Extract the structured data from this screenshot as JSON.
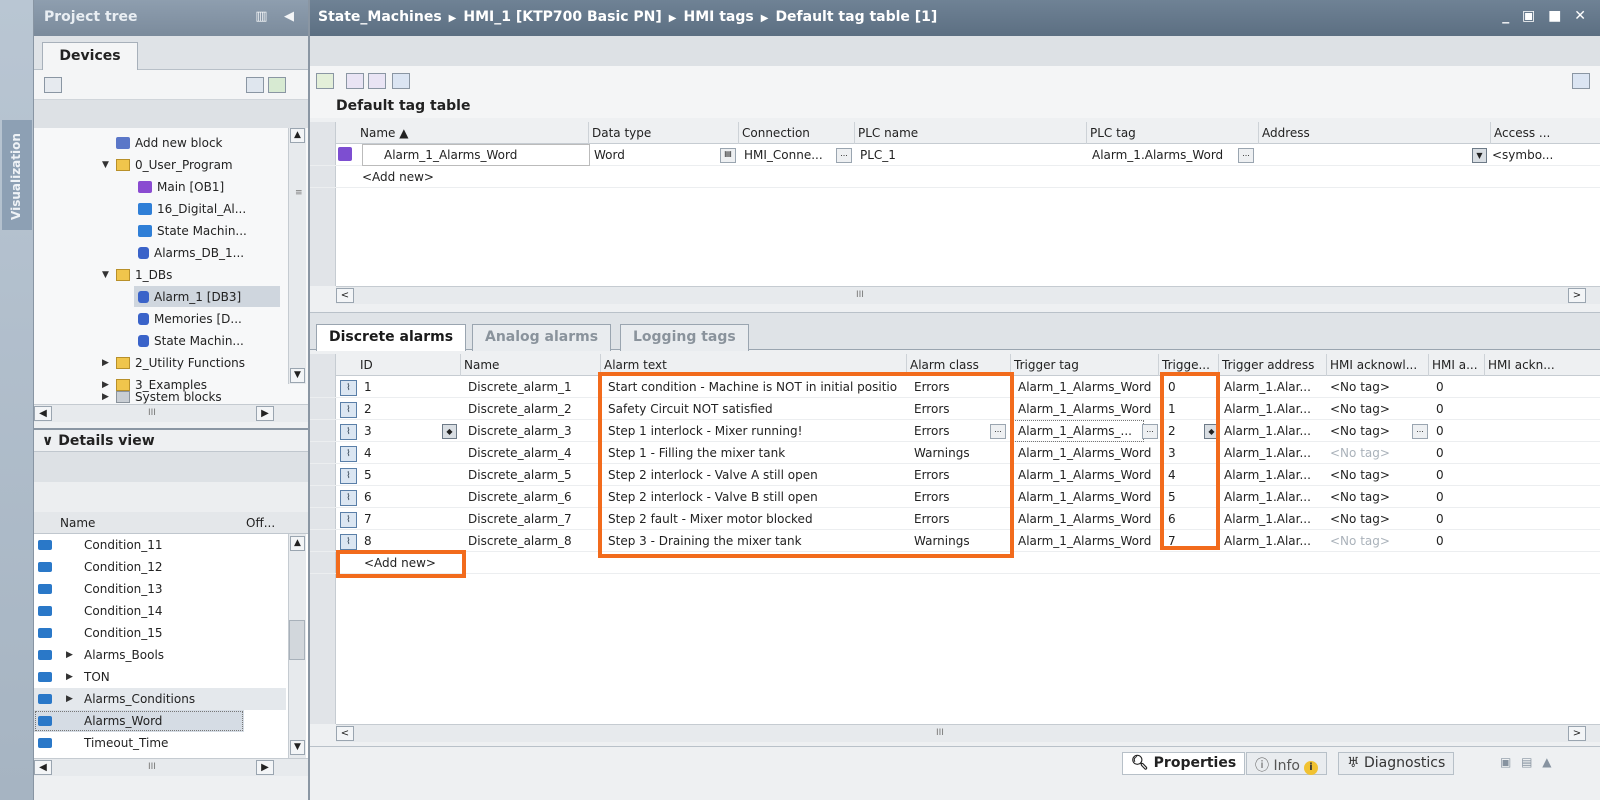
{
  "side_strip": {
    "label": "Visualization"
  },
  "project_tree": {
    "title": "Project tree",
    "tab": "Devices",
    "items": [
      {
        "label": "Add new block",
        "icon": "add-block-icon"
      },
      {
        "label": "0_User_Program",
        "icon": "folder-icon"
      },
      {
        "label": "Main [OB1]",
        "icon": "ob-icon"
      },
      {
        "label": "16_Digital_Al...",
        "icon": "fb-icon"
      },
      {
        "label": "State Machin...",
        "icon": "fb-icon"
      },
      {
        "label": "Alarms_DB_1...",
        "icon": "db-icon"
      },
      {
        "label": "1_DBs",
        "icon": "folder-icon"
      },
      {
        "label": "Alarm_1 [DB3]",
        "icon": "db-icon"
      },
      {
        "label": "Memories [D...",
        "icon": "db-icon"
      },
      {
        "label": "State Machin...",
        "icon": "db-icon"
      },
      {
        "label": "2_Utility Functions",
        "icon": "folder-icon"
      },
      {
        "label": "3_Examples",
        "icon": "folder-icon"
      },
      {
        "label": "System blocks",
        "icon": "folder-icon"
      }
    ]
  },
  "details_view": {
    "title": "Details view",
    "col_name": "Name",
    "col_offset": "Off...",
    "items": [
      "Condition_11",
      "Condition_12",
      "Condition_13",
      "Condition_14",
      "Condition_15",
      "Alarms_Bools",
      "TON",
      "Alarms_Conditions",
      "Alarms_Word",
      "Timeout_Time"
    ]
  },
  "breadcrumb": {
    "parts": [
      "State_Machines",
      "HMI_1 [KTP700 Basic PN]",
      "HMI tags",
      "Default tag table [1]"
    ],
    "window_controls": "_ ▣ ■ ✕"
  },
  "tag_table": {
    "title": "Default tag table",
    "columns": [
      "Name ▲",
      "Data type",
      "Connection",
      "PLC name",
      "PLC tag",
      "Address",
      "Access ..."
    ],
    "row": {
      "name": "Alarm_1_Alarms_Word",
      "data_type": "Word",
      "connection": "HMI_Conne...",
      "plc_name": "PLC_1",
      "plc_tag": "Alarm_1.Alarms_Word",
      "access": "<symbo..."
    },
    "add_new": "<Add new>"
  },
  "alarm_tabs": [
    "Discrete alarms",
    "Analog alarms",
    "Logging tags"
  ],
  "alarms": {
    "columns": [
      "ID",
      "Name",
      "Alarm text",
      "Alarm class",
      "Trigger tag",
      "Trigge...",
      "Trigger address",
      "HMI acknowl...",
      "HMI a...",
      "HMI ackn..."
    ],
    "rows": [
      {
        "id": "1",
        "name": "Discrete_alarm_1",
        "text": "Start condition - Machine is NOT in initial positio",
        "class": "Errors",
        "tag": "Alarm_1_Alarms_Word",
        "bit": "0",
        "addr": "Alarm_1.Alar...",
        "ack": "<No tag>",
        "ackb": "0"
      },
      {
        "id": "2",
        "name": "Discrete_alarm_2",
        "text": "Safety Circuit NOT satisfied",
        "class": "Errors",
        "tag": "Alarm_1_Alarms_Word",
        "bit": "1",
        "addr": "Alarm_1.Alar...",
        "ack": "<No tag>",
        "ackb": "0"
      },
      {
        "id": "3",
        "name": "Discrete_alarm_3",
        "text": "Step 1 interlock - Mixer running!",
        "class": "Errors",
        "tag": "Alarm_1_Alarms_...",
        "bit": "2",
        "addr": "Alarm_1.Alar...",
        "ack": "<No tag>",
        "ackb": "0"
      },
      {
        "id": "4",
        "name": "Discrete_alarm_4",
        "text": "Step 1 - Filling the mixer tank",
        "class": "Warnings",
        "tag": "Alarm_1_Alarms_Word",
        "bit": "3",
        "addr": "Alarm_1.Alar...",
        "ack": "<No tag>",
        "ackb": "0"
      },
      {
        "id": "5",
        "name": "Discrete_alarm_5",
        "text": "Step 2 interlock - Valve A still open",
        "class": "Errors",
        "tag": "Alarm_1_Alarms_Word",
        "bit": "4",
        "addr": "Alarm_1.Alar...",
        "ack": "<No tag>",
        "ackb": "0"
      },
      {
        "id": "6",
        "name": "Discrete_alarm_6",
        "text": "Step 2 interlock - Valve B still open",
        "class": "Errors",
        "tag": "Alarm_1_Alarms_Word",
        "bit": "5",
        "addr": "Alarm_1.Alar...",
        "ack": "<No tag>",
        "ackb": "0"
      },
      {
        "id": "7",
        "name": "Discrete_alarm_7",
        "text": "Step 2 fault - Mixer motor blocked",
        "class": "Errors",
        "tag": "Alarm_1_Alarms_Word",
        "bit": "6",
        "addr": "Alarm_1.Alar...",
        "ack": "<No tag>",
        "ackb": "0"
      },
      {
        "id": "8",
        "name": "Discrete_alarm_8",
        "text": "Step 3 - Draining the mixer tank",
        "class": "Warnings",
        "tag": "Alarm_1_Alarms_Word",
        "bit": "7",
        "addr": "Alarm_1.Alar...",
        "ack": "<No tag>",
        "ackb": "0"
      }
    ],
    "add_new": "<Add new>"
  },
  "status_bar": {
    "properties": "Properties",
    "info": "Info",
    "info_badge": "i",
    "diagnostics": "Diagnostics"
  },
  "colors": {
    "highlight": "#f26b1c",
    "title_bar": "#5c6f82"
  }
}
